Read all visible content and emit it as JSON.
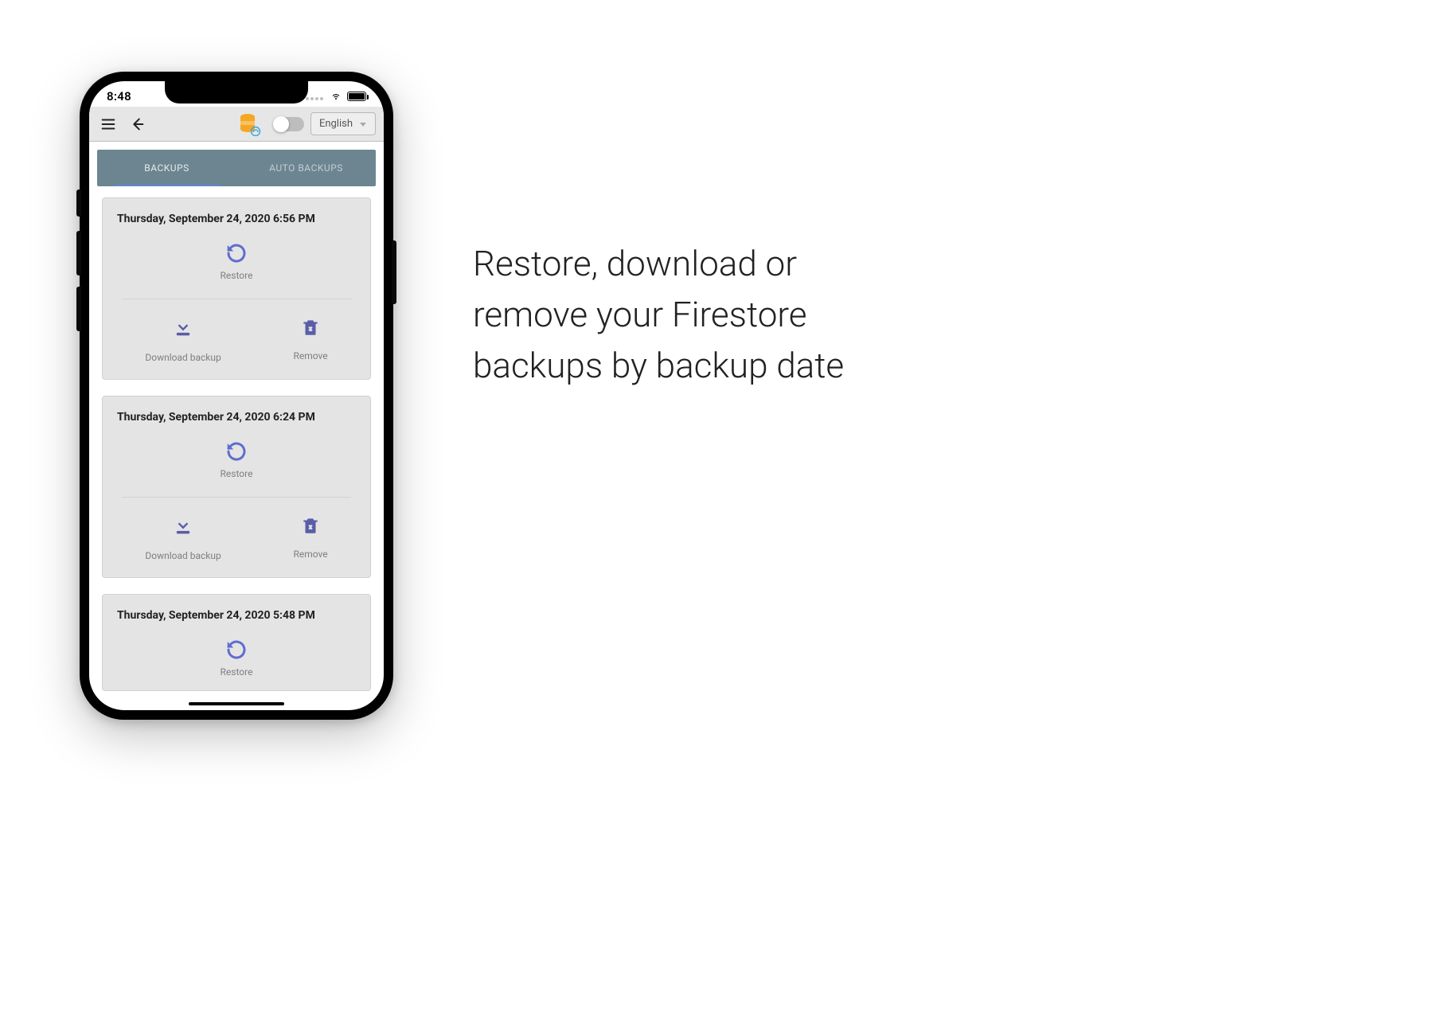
{
  "status": {
    "time": "8:48"
  },
  "appbar": {
    "language": "English"
  },
  "tabs": [
    {
      "label": "BACKUPS",
      "active": true
    },
    {
      "label": "AUTO BACKUPS",
      "active": false
    }
  ],
  "labels": {
    "restore": "Restore",
    "download": "Download backup",
    "remove": "Remove"
  },
  "backups": [
    {
      "title": "Thursday, September 24, 2020 6:56 PM"
    },
    {
      "title": "Thursday, September 24, 2020 6:24 PM"
    },
    {
      "title": "Thursday, September 24, 2020 5:48 PM"
    }
  ],
  "marketing": {
    "text": "Restore, download or remove your Firestore backups by backup date"
  }
}
